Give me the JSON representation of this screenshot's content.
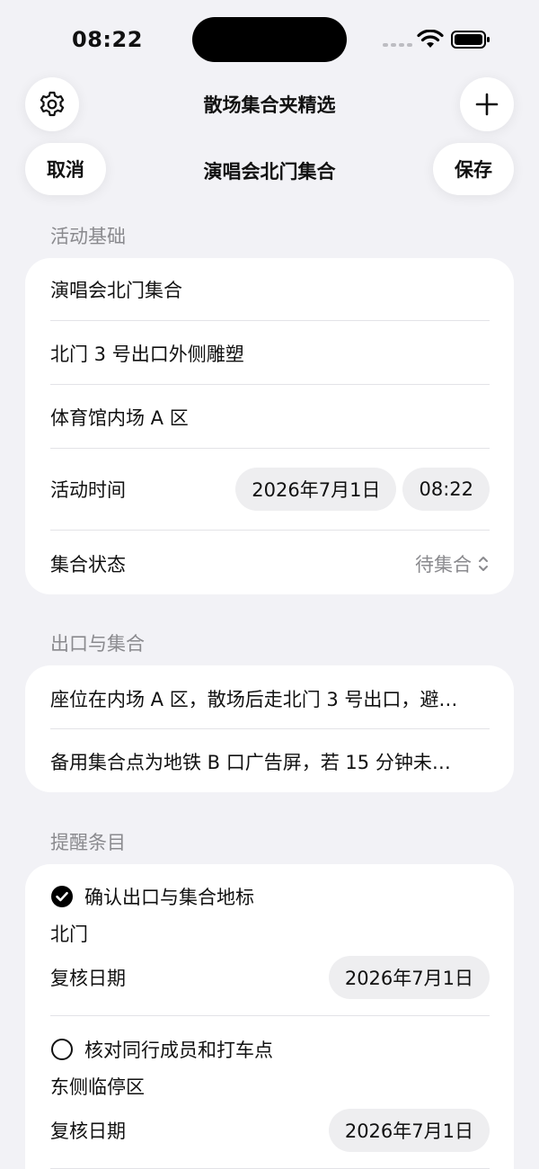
{
  "status_bar": {
    "time": "08:22"
  },
  "nav": {
    "title": "散场集合夹精选",
    "sheet_title": "演唱会北门集合",
    "cancel_label": "取消",
    "save_label": "保存"
  },
  "basics": {
    "header": "活动基础",
    "name": "演唱会北门集合",
    "meeting_point": "北门 3 号出口外侧雕塑",
    "venue_zone": "体育馆内场 A 区",
    "time_label": "活动时间",
    "date_value": "2026年7月1日",
    "time_value": "08:22",
    "status_label": "集合状态",
    "status_value": "待集合"
  },
  "exit": {
    "header": "出口与集合",
    "note1": "座位在内场 A 区，散场后走北门 3 号出口，避…",
    "note2": "备用集合点为地铁 B 口广告屏，若 15 分钟未…"
  },
  "reminders": {
    "header": "提醒条目",
    "items": [
      {
        "title": "确认出口与集合地标",
        "location": "北门",
        "date_label": "复核日期",
        "date_value": "2026年7月1日",
        "done": true
      },
      {
        "title": "核对同行成员和打车点",
        "location": "东侧临停区",
        "date_label": "复核日期",
        "date_value": "2026年7月1日",
        "done": false
      }
    ]
  }
}
